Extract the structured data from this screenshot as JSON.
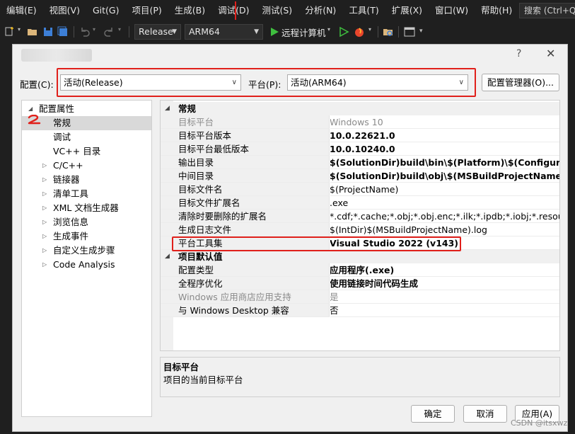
{
  "menubar": {
    "items": [
      "编辑(E)",
      "视图(V)",
      "Git(G)",
      "项目(P)",
      "生成(B)",
      "调试(D)",
      "测试(S)",
      "分析(N)",
      "工具(T)",
      "扩展(X)",
      "窗口(W)",
      "帮助(H)"
    ],
    "search": "搜索 (Ctrl+Q)"
  },
  "toolbar": {
    "config": "Release",
    "platform": "ARM64",
    "run_target": "远程计算机"
  },
  "dialog": {
    "title_help": "?",
    "title_close": "✕",
    "config_label": "配置(C):",
    "config_value": "活动(Release)",
    "platform_label": "平台(P):",
    "platform_value": "活动(ARM64)",
    "config_manager": "配置管理器(O)...",
    "tree": [
      {
        "label": "配置属性",
        "expander": "◢",
        "indent": 0
      },
      {
        "label": "常规",
        "expander": "",
        "indent": 1,
        "selected": true
      },
      {
        "label": "调试",
        "expander": "",
        "indent": 1
      },
      {
        "label": "VC++ 目录",
        "expander": "",
        "indent": 1
      },
      {
        "label": "C/C++",
        "expander": "▷",
        "indent": 1
      },
      {
        "label": "链接器",
        "expander": "▷",
        "indent": 1
      },
      {
        "label": "清单工具",
        "expander": "▷",
        "indent": 1
      },
      {
        "label": "XML 文档生成器",
        "expander": "▷",
        "indent": 1
      },
      {
        "label": "浏览信息",
        "expander": "▷",
        "indent": 1
      },
      {
        "label": "生成事件",
        "expander": "▷",
        "indent": 1
      },
      {
        "label": "自定义生成步骤",
        "expander": "▷",
        "indent": 1
      },
      {
        "label": "Code Analysis",
        "expander": "▷",
        "indent": 1
      }
    ],
    "categories": [
      {
        "name": "常规",
        "rows": [
          {
            "name": "目标平台",
            "value": "Windows 10",
            "dim": true
          },
          {
            "name": "目标平台版本",
            "value": "10.0.22621.0",
            "bold": true
          },
          {
            "name": "目标平台最低版本",
            "value": "10.0.10240.0",
            "bold": true
          },
          {
            "name": "输出目录",
            "value": "$(SolutionDir)build\\bin\\$(Platform)\\$(Configuration)\\",
            "bold": true
          },
          {
            "name": "中间目录",
            "value": "$(SolutionDir)build\\obj\\$(MSBuildProjectName)\\$(Platform)\\",
            "bold": true
          },
          {
            "name": "目标文件名",
            "value": "$(ProjectName)"
          },
          {
            "name": "目标文件扩展名",
            "value": ".exe"
          },
          {
            "name": "清除时要删除的扩展名",
            "value": "*.cdf;*.cache;*.obj;*.obj.enc;*.ilk;*.ipdb;*.iobj;*.resources;*.tlb"
          },
          {
            "name": "生成日志文件",
            "value": "$(IntDir)$(MSBuildProjectName).log"
          },
          {
            "name": "平台工具集",
            "value": "Visual Studio 2022 (v143)",
            "bold": true
          }
        ]
      },
      {
        "name": "项目默认值",
        "rows": [
          {
            "name": "配置类型",
            "value": "应用程序(.exe)",
            "bold": true
          },
          {
            "name": "全程序优化",
            "value": "使用链接时间代码生成",
            "bold": true
          },
          {
            "name": "Windows 应用商店应用支持",
            "value": "是",
            "dim": true
          },
          {
            "name": "与 Windows Desktop 兼容",
            "value": "否"
          }
        ]
      }
    ],
    "description": {
      "title": "目标平台",
      "text": "项目的当前目标平台"
    },
    "buttons": {
      "ok": "确定",
      "cancel": "取消",
      "apply": "应用(A)"
    }
  },
  "watermark": "CSDN @itsxwz",
  "colors": {
    "annotation_red": "#e0201b",
    "chrome_dark": "#1f1f1f",
    "dialog_bg": "#f0f0f0"
  }
}
